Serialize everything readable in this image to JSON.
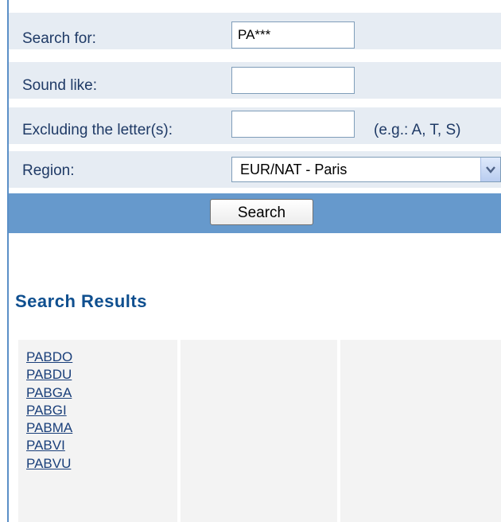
{
  "form": {
    "search_for_label": "Search for:",
    "search_for_value": "PA***",
    "sound_like_label": "Sound like:",
    "sound_like_value": "",
    "excluding_label": "Excluding the letter(s):",
    "excluding_value": "",
    "excluding_hint": "(e.g.: A, T, S)",
    "region_label": "Region:",
    "region_selected": "EUR/NAT - Paris",
    "search_button": "Search"
  },
  "results": {
    "title": "Search Results",
    "items": [
      "PABDO",
      "PABDU",
      "PABGA",
      "PABGI",
      "PABMA",
      "PABVI",
      "PABVU"
    ]
  },
  "colors": {
    "accent_bar": "#6699cc",
    "row_background": "#e6ecf3",
    "title": "#0f4f8f"
  },
  "icons": {
    "dropdown": "chevron-down-icon"
  }
}
